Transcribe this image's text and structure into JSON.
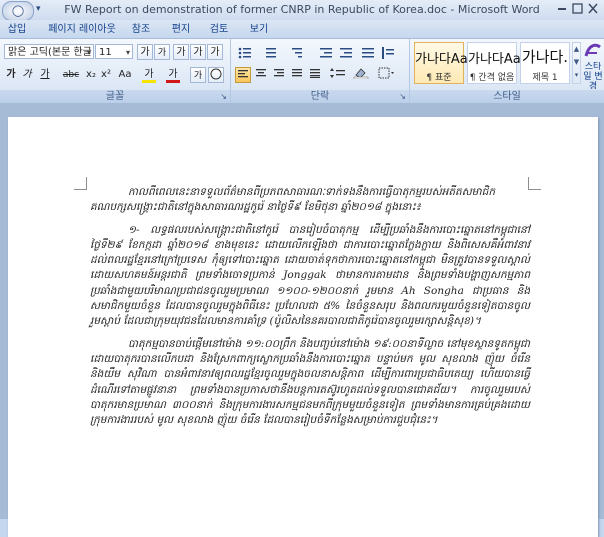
{
  "window": {
    "title": "FW Report on demonstration of former CNRP in Republic of Korea.doc - Microsoft Word",
    "office_button_glyph": "◯"
  },
  "tabs": [
    "삽입",
    "페이지 레이아웃",
    "참조",
    "편지",
    "검토",
    "보기"
  ],
  "ribbon": {
    "font": {
      "name": "맑은 고딕(본문 한글",
      "size": "11",
      "group_label": "글꼴",
      "row1": [
        "가",
        "가",
        "가",
        "가",
        "가",
        "가",
        "가",
        "가"
      ],
      "row2": [
        "가",
        "가",
        "가",
        "abc",
        "x₂",
        "x²",
        "Aa",
        "가",
        "가",
        "가"
      ]
    },
    "paragraph": {
      "group_label": "단락"
    },
    "styles": {
      "group_label": "스타일",
      "items": [
        {
          "sample": "가나다Aa",
          "name": "표준"
        },
        {
          "sample": "가나다Aa",
          "name": "간격 없음"
        },
        {
          "sample": "가나다.",
          "name": "제목 1"
        }
      ],
      "change_label": "스타일 변경"
    }
  },
  "document": {
    "paragraphs": [
      "កាលពីពេលនេះនាទទួលព័ត៌មានពីប្រភពសាធារណៈទាក់ទងនឹងការធ្វើបាតុកម្មរបស់អតីតសមាជិកគណបក្សសង្គ្រោះជាតិនៅក្នុងសាធារណរដ្ឋកូរ៉េ នាថ្ងៃទី៩ ខែមិថុនា ឆ្នាំ២០១៨ ក្នុងនោះ៖",
      "១- លទ្ធផលរបស់សង្គ្រោះជាតិនៅកូរ៉េ បានរៀបចំបាតុកម្ម ដើម្បីប្រឆាំងនឹងការបោះឆ្នោតនៅកម្ពុជានៅថ្ងៃទី២៩ ខែកក្កដា ឆ្នាំ២០១៨ ខាងមុខនេះ ដោយលើកឡើងថា ជាការបោះឆ្នោតក្លែងក្លាយ និងពិសេសគឺអំពាវនាវដល់ពលរដ្ឋខ្មែរនៅក្រៅប្រទេស កុំឲ្យទៅបោះឆ្នោត ដោយចាត់ទុកថាការបោះឆ្នោតនៅកម្ពុជា មិនត្រូវបានទទួលស្គាល់ដោយសហគមន៍អន្តរជាតិ ព្រមទាំងចោទប្រកាន់ Jonggak ថាមានការតាមដាន និងព្រមទាំងបង្ហាញសកម្មភាពប្រឆាំងជាមួយបរិមាណប្រជាជនចូលរួមប្រមាណ ១១០០-១២០០នាក់ រួមមាន Ah Songha ជាប្រធាន និងសមាជិកមួយចំនួន ដែលបានចូលរួមក្នុងពិធីនេះ ប្រហែលជា ៥% នៃចំនួនសរុប និងពលករមួយចំនួនទៀតបានចូលរួមស្តាប់ ដែលជាក្រុមយុវជនដែលមានការគាំទ្រ (ប៉ូលិសនៃនគរបាលជាតិកូរ៉េបានចូលរួមរក្សាសន្តិសុខ)។",
      "បាតុកម្មបានចាប់ផ្តើមនៅម៉ោង ១១:០០ព្រឹក និងបញ្ចប់នៅម៉ោង ១៩:០០នាទីល្ងាច នៅមុខស្ថានទូតកម្ពុជា ដោយបាតុករបានលើកបដា និងស្រែកពាក្យស្លោកប្រឆាំងនឹងការបោះឆ្នោត បន្ទាប់មក មូល សុខលាង ញ៉ុយ ចំរើន និងយឹម សុវិណា បានអំពាវនាវឲ្យពលរដ្ឋខ្មែរចូលរួមក្នុងចលនាសន្តិភាព ដើម្បីការពារប្រជាធិបតេយ្យ ហើយបានធ្វើដំណើរទៅតាមផ្លូវនានា ព្រមទាំងបានប្រកាសថានឹងបន្តការតស៊ូរហូតដល់ទទួលបានជោគជ័យ។ ការចូលរួមរបស់បាតុករមានប្រមាណ ៣០០នាក់ និងក្រុមការងារសកម្មជនមកពីក្រុមមួយចំនួនទៀត ព្រមទាំងមានការគ្រប់គ្រងដោយក្រុមការងាររបស់ មូល សុខលាង ញ៉ុយ ចំរើន ដែលបានរៀបចំទីកន្លែងសម្រាប់ការជួបជុំនេះ។"
    ]
  }
}
